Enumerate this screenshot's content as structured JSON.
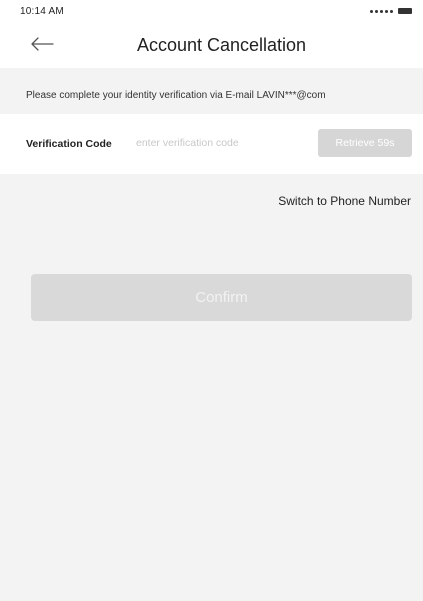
{
  "status_bar": {
    "time": "10:14 AM",
    "signal_icon": "signal-dots-icon",
    "battery_icon": "battery-icon"
  },
  "header": {
    "back_icon": "back-arrow-icon",
    "title": "Account Cancellation"
  },
  "verification": {
    "instruction": "Please complete your identity verification via E-mail LAVIN***@com",
    "code_label": "Verification Code",
    "code_value": "",
    "code_placeholder": "enter verification code",
    "retrieve_label": "Retrieve 59s"
  },
  "switch_label": "Switch to Phone Number",
  "confirm_label": "Confirm",
  "colors": {
    "background": "#f3f3f3",
    "surface": "#ffffff",
    "disabled_button": "#d9d9d9",
    "placeholder": "#c8c8c8"
  }
}
